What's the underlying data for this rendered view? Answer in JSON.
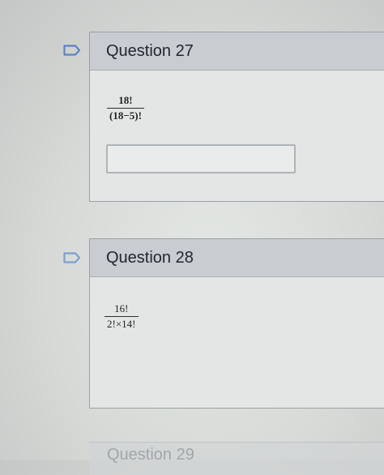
{
  "questions": [
    {
      "title": "Question 27",
      "numerator": "18!",
      "denominator": "(18−5)!",
      "answer_value": ""
    },
    {
      "title": "Question 28",
      "numerator": "16!",
      "denominator": "2!×14!"
    }
  ],
  "next_question_partial": "Question 29",
  "icons": {
    "flag": "flag-outline-icon"
  },
  "colors": {
    "header_bg": "#c9ccd1",
    "body_bg": "#e3e6e4",
    "flag_stroke": "#5a84c4"
  }
}
